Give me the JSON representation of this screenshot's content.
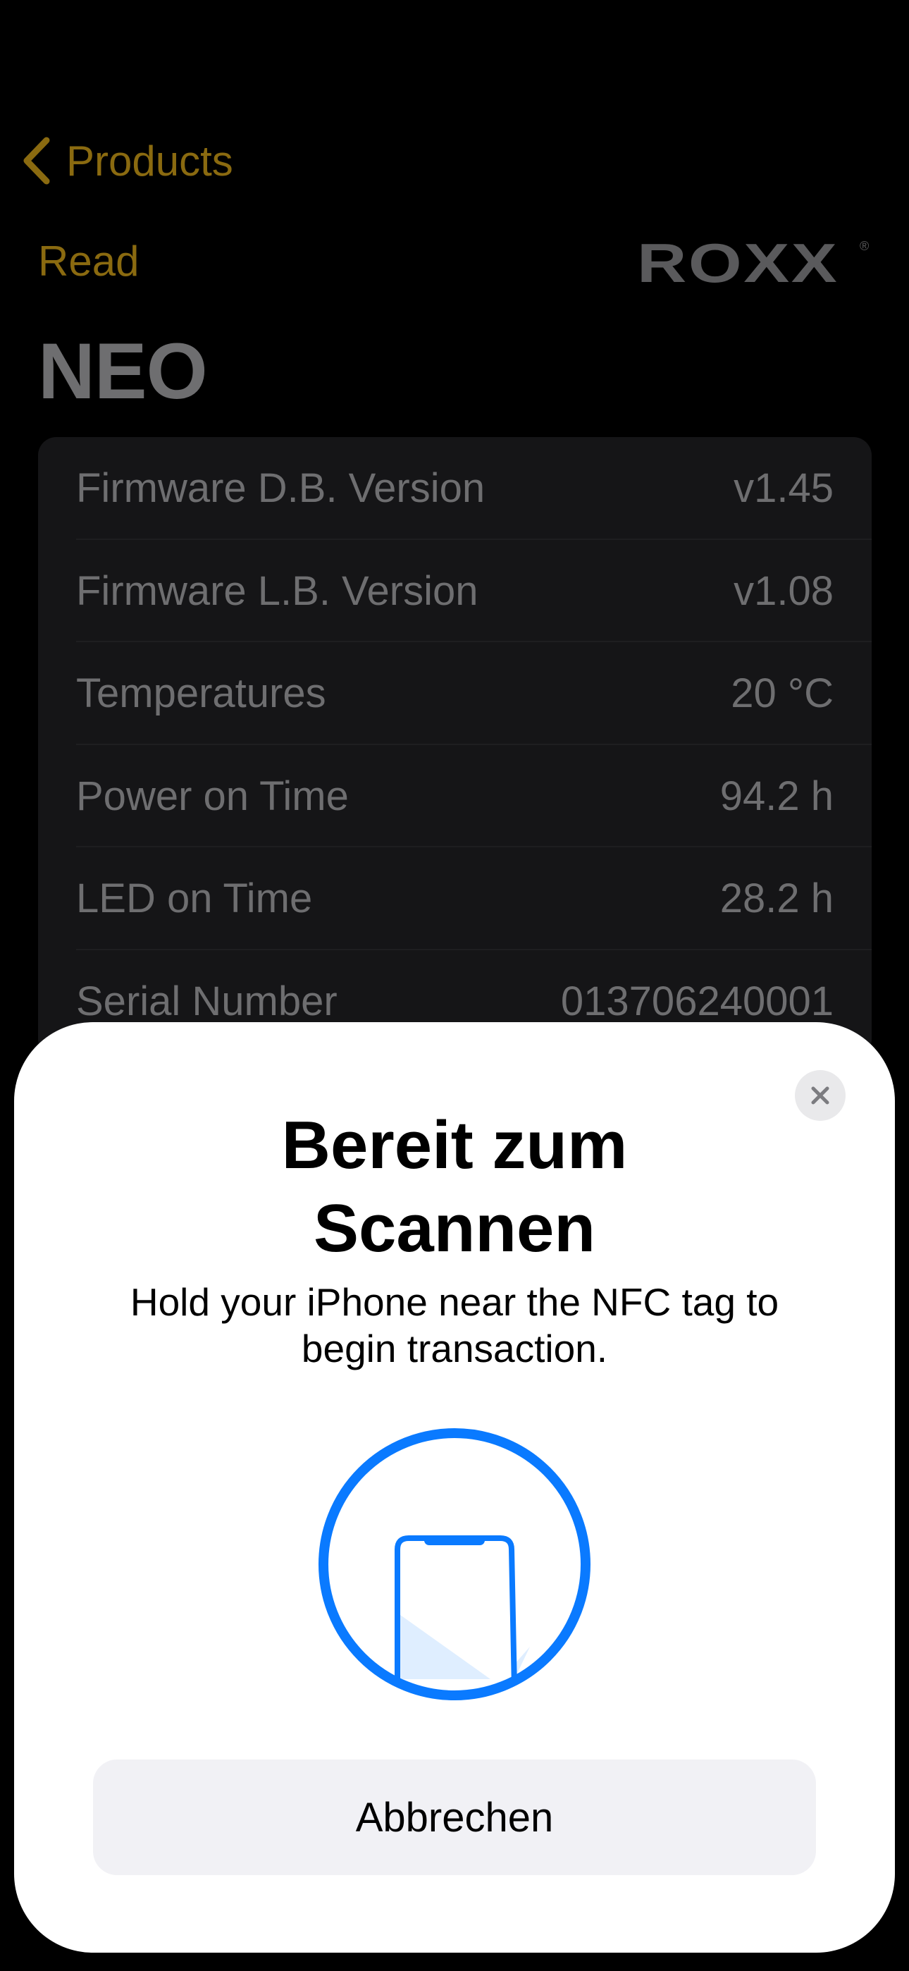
{
  "nav": {
    "back_label": "Products"
  },
  "header": {
    "read_label": "Read",
    "brand": "ROXX",
    "brand_mark": "®",
    "title": "NEO"
  },
  "device_info": [
    {
      "label": "Firmware D.B. Version",
      "value": "v1.45"
    },
    {
      "label": "Firmware L.B. Version",
      "value": "v1.08"
    },
    {
      "label": "Temperatures",
      "value": "20 °C"
    },
    {
      "label": "Power on Time",
      "value": "94.2 h"
    },
    {
      "label": "LED on Time",
      "value": "28.2 h"
    },
    {
      "label": "Serial Number",
      "value": "013706240001"
    }
  ],
  "nfc_sheet": {
    "title_line1": "Bereit zum",
    "title_line2": "Scannen",
    "message_line1": "Hold your iPhone near the NFC tag to",
    "message_line2": "begin transaction.",
    "cancel_label": "Abbrechen"
  },
  "colors": {
    "accent": "#8a6a10",
    "nfc_blue": "#0a7aff",
    "sheet_bg": "#ffffff",
    "cancel_bg": "#f1f1f5"
  },
  "icons": {
    "back": "chevron-left-icon",
    "close": "close-icon",
    "nfc": "phone-scan-icon"
  }
}
